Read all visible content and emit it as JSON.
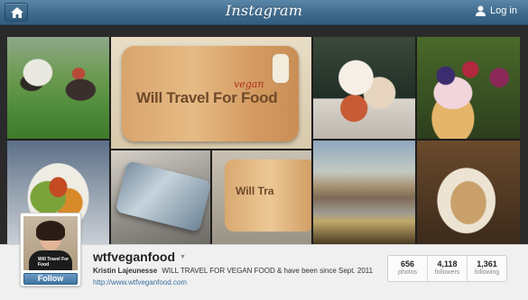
{
  "header": {
    "brand": "Instagram",
    "login_label": "Log in"
  },
  "mosaic": {
    "case_text": "Will Travel For Food",
    "case_vegan": "vegan",
    "phone_text": "Will Tra"
  },
  "profile": {
    "username": "wtfveganfood",
    "follow_label": "Follow",
    "avatar_shirt_text": "Will Travel For Food",
    "bio_name": "Kristin Lajeunesse",
    "bio_text": "WILL TRAVEL FOR VEGAN FOOD & have been since Sept. 2011",
    "website": "http://www.wtfveganfood.com",
    "stats": [
      {
        "value": "656",
        "label": "photos"
      },
      {
        "value": "4,118",
        "label": "followers"
      },
      {
        "value": "1,361",
        "label": "following"
      }
    ]
  },
  "colors": {
    "nav_blue": "#3f6a8c",
    "link_blue": "#3b6fa0",
    "follow_blue": "#3f74a1"
  }
}
